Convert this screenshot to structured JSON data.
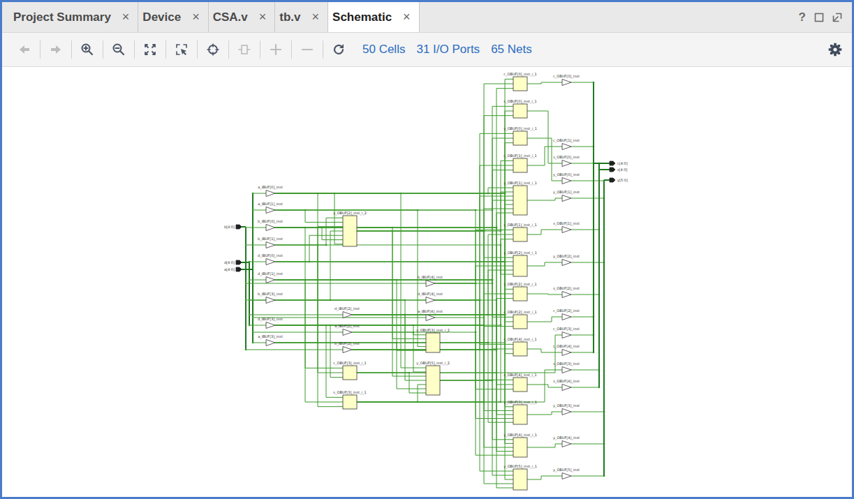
{
  "tabs": [
    {
      "label": "Project Summary",
      "close": "×",
      "selected": false
    },
    {
      "label": "Device",
      "close": "×",
      "selected": false
    },
    {
      "label": "CSA.v",
      "close": "×",
      "selected": false
    },
    {
      "label": "tb.v",
      "close": "×",
      "selected": false
    },
    {
      "label": "Schematic",
      "close": "×",
      "selected": true
    }
  ],
  "window_controls": {
    "help": "?"
  },
  "toolbar": {
    "buttons": [
      {
        "disabled": true
      },
      {
        "disabled": true
      },
      {
        "disabled": false
      },
      {
        "disabled": false
      },
      {
        "disabled": false
      },
      {
        "disabled": false
      },
      {
        "disabled": false
      },
      {
        "disabled": true
      },
      {
        "disabled": true
      },
      {
        "disabled": true
      },
      {
        "disabled": false
      }
    ],
    "stats": [
      "50 Cells",
      "31 I/O Ports",
      "65 Nets"
    ]
  },
  "schematic": {
    "input_ports": [
      "b[4:0]",
      "d[4:0]",
      "a[4:0]"
    ],
    "output_ports": [
      "c[4:0]",
      "s[4:0]",
      "y[5:0]"
    ],
    "input_buffers": [
      "a_IBUF[0]_inst",
      "a_IBUF[1]_inst",
      "b_IBUF[0]_inst",
      "b_IBUF[1]_inst",
      "d_IBUF[0]_inst",
      "d_IBUF[1]_inst",
      "b_IBUF[3]_inst",
      "d_IBUF[3]_inst",
      "a_IBUF[3]_inst",
      "b_IBUF[4]_inst",
      "d_IBUF[4]_inst",
      "a_IBUF[4]_inst",
      "d_IBUF[2]_inst",
      "a_IBUF[2]_inst",
      "b_IBUF[2]_inst"
    ],
    "output_buffers": [
      "c_OBUF[0]_inst",
      "c_OBUF[1]_inst",
      "s_OBUF[0]_inst",
      "y_OBUF[0]_inst",
      "y_OBUF[1]_inst",
      "s_OBUF[1]_inst",
      "y_OBUF[2]_inst",
      "s_OBUF[2]_inst",
      "c_OBUF[2]_inst",
      "c_OBUF[3]_inst",
      "c_OBUF[4]_inst",
      "s_OBUF[3]_inst",
      "s_OBUF[4]_inst",
      "y_OBUF[3]_inst",
      "y_OBUF[4]_inst",
      "y_OBUF[5]_inst"
    ],
    "cells": [
      "c_OBUF[0]_inst_i_1",
      "s_OBUF[0]_inst_i_1",
      "y_OBUF[0]_inst_i_1",
      "c_OBUF[1]_inst_i_1",
      "y_OBUF[1]_inst_i_1",
      "s_OBUF[1]_inst_i_1",
      "y_OBUF[2]_inst_i_2",
      "y_OBUF[2]_inst_i_1",
      "s_OBUF[2]_inst_i_1",
      "c_OBUF[2]_inst_i_1",
      "c_OBUF[4]_inst_i_1",
      "y_OBUF[3]_inst_i_2",
      "y_OBUF[5]_inst_i_2",
      "c_OBUF[3]_inst_i_1",
      "s_OBUF[3]_inst_i_1",
      "s_OBUF[4]_inst_i_1",
      "y_OBUF[3]_inst_i_1",
      "y_OBUF[4]_inst_i_1",
      "y_OBUF[5]_inst_i_1"
    ]
  }
}
